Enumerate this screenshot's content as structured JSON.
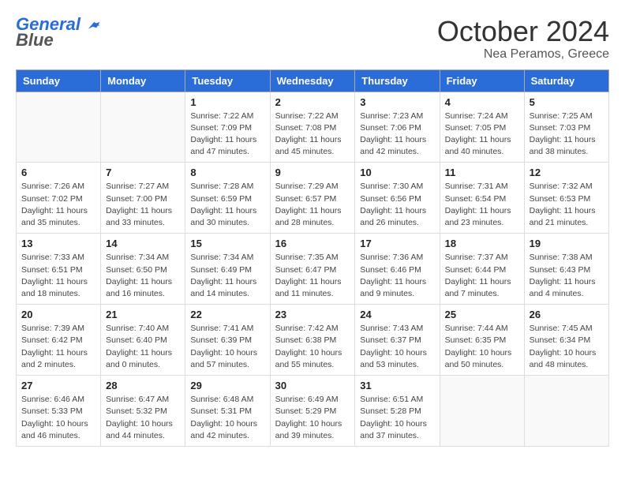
{
  "header": {
    "logo_general": "General",
    "logo_blue": "Blue",
    "month_title": "October 2024",
    "location": "Nea Peramos, Greece"
  },
  "calendar": {
    "days_of_week": [
      "Sunday",
      "Monday",
      "Tuesday",
      "Wednesday",
      "Thursday",
      "Friday",
      "Saturday"
    ],
    "weeks": [
      [
        {
          "day": "",
          "info": ""
        },
        {
          "day": "",
          "info": ""
        },
        {
          "day": "1",
          "info": "Sunrise: 7:22 AM\nSunset: 7:09 PM\nDaylight: 11 hours and 47 minutes."
        },
        {
          "day": "2",
          "info": "Sunrise: 7:22 AM\nSunset: 7:08 PM\nDaylight: 11 hours and 45 minutes."
        },
        {
          "day": "3",
          "info": "Sunrise: 7:23 AM\nSunset: 7:06 PM\nDaylight: 11 hours and 42 minutes."
        },
        {
          "day": "4",
          "info": "Sunrise: 7:24 AM\nSunset: 7:05 PM\nDaylight: 11 hours and 40 minutes."
        },
        {
          "day": "5",
          "info": "Sunrise: 7:25 AM\nSunset: 7:03 PM\nDaylight: 11 hours and 38 minutes."
        }
      ],
      [
        {
          "day": "6",
          "info": "Sunrise: 7:26 AM\nSunset: 7:02 PM\nDaylight: 11 hours and 35 minutes."
        },
        {
          "day": "7",
          "info": "Sunrise: 7:27 AM\nSunset: 7:00 PM\nDaylight: 11 hours and 33 minutes."
        },
        {
          "day": "8",
          "info": "Sunrise: 7:28 AM\nSunset: 6:59 PM\nDaylight: 11 hours and 30 minutes."
        },
        {
          "day": "9",
          "info": "Sunrise: 7:29 AM\nSunset: 6:57 PM\nDaylight: 11 hours and 28 minutes."
        },
        {
          "day": "10",
          "info": "Sunrise: 7:30 AM\nSunset: 6:56 PM\nDaylight: 11 hours and 26 minutes."
        },
        {
          "day": "11",
          "info": "Sunrise: 7:31 AM\nSunset: 6:54 PM\nDaylight: 11 hours and 23 minutes."
        },
        {
          "day": "12",
          "info": "Sunrise: 7:32 AM\nSunset: 6:53 PM\nDaylight: 11 hours and 21 minutes."
        }
      ],
      [
        {
          "day": "13",
          "info": "Sunrise: 7:33 AM\nSunset: 6:51 PM\nDaylight: 11 hours and 18 minutes."
        },
        {
          "day": "14",
          "info": "Sunrise: 7:34 AM\nSunset: 6:50 PM\nDaylight: 11 hours and 16 minutes."
        },
        {
          "day": "15",
          "info": "Sunrise: 7:34 AM\nSunset: 6:49 PM\nDaylight: 11 hours and 14 minutes."
        },
        {
          "day": "16",
          "info": "Sunrise: 7:35 AM\nSunset: 6:47 PM\nDaylight: 11 hours and 11 minutes."
        },
        {
          "day": "17",
          "info": "Sunrise: 7:36 AM\nSunset: 6:46 PM\nDaylight: 11 hours and 9 minutes."
        },
        {
          "day": "18",
          "info": "Sunrise: 7:37 AM\nSunset: 6:44 PM\nDaylight: 11 hours and 7 minutes."
        },
        {
          "day": "19",
          "info": "Sunrise: 7:38 AM\nSunset: 6:43 PM\nDaylight: 11 hours and 4 minutes."
        }
      ],
      [
        {
          "day": "20",
          "info": "Sunrise: 7:39 AM\nSunset: 6:42 PM\nDaylight: 11 hours and 2 minutes."
        },
        {
          "day": "21",
          "info": "Sunrise: 7:40 AM\nSunset: 6:40 PM\nDaylight: 11 hours and 0 minutes."
        },
        {
          "day": "22",
          "info": "Sunrise: 7:41 AM\nSunset: 6:39 PM\nDaylight: 10 hours and 57 minutes."
        },
        {
          "day": "23",
          "info": "Sunrise: 7:42 AM\nSunset: 6:38 PM\nDaylight: 10 hours and 55 minutes."
        },
        {
          "day": "24",
          "info": "Sunrise: 7:43 AM\nSunset: 6:37 PM\nDaylight: 10 hours and 53 minutes."
        },
        {
          "day": "25",
          "info": "Sunrise: 7:44 AM\nSunset: 6:35 PM\nDaylight: 10 hours and 50 minutes."
        },
        {
          "day": "26",
          "info": "Sunrise: 7:45 AM\nSunset: 6:34 PM\nDaylight: 10 hours and 48 minutes."
        }
      ],
      [
        {
          "day": "27",
          "info": "Sunrise: 6:46 AM\nSunset: 5:33 PM\nDaylight: 10 hours and 46 minutes."
        },
        {
          "day": "28",
          "info": "Sunrise: 6:47 AM\nSunset: 5:32 PM\nDaylight: 10 hours and 44 minutes."
        },
        {
          "day": "29",
          "info": "Sunrise: 6:48 AM\nSunset: 5:31 PM\nDaylight: 10 hours and 42 minutes."
        },
        {
          "day": "30",
          "info": "Sunrise: 6:49 AM\nSunset: 5:29 PM\nDaylight: 10 hours and 39 minutes."
        },
        {
          "day": "31",
          "info": "Sunrise: 6:51 AM\nSunset: 5:28 PM\nDaylight: 10 hours and 37 minutes."
        },
        {
          "day": "",
          "info": ""
        },
        {
          "day": "",
          "info": ""
        }
      ]
    ]
  }
}
